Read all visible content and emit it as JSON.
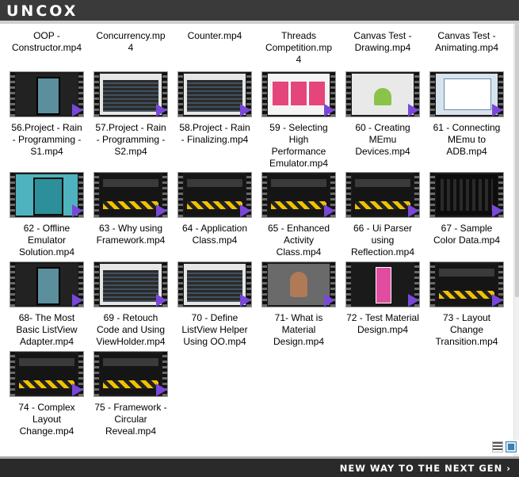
{
  "header": {
    "brand": "UNCOX"
  },
  "footer": {
    "tagline": "NEW WAY TO THE NEXT GEN ›"
  },
  "files": [
    {
      "label": "OOP -\nConstructor.mp4",
      "thumb": "none"
    },
    {
      "label": "Concurrency.mp\n4",
      "thumb": "none"
    },
    {
      "label": "Counter.mp4",
      "thumb": "none"
    },
    {
      "label": "Threads\nCompetition.mp\n4",
      "thumb": "none"
    },
    {
      "label": "Canvas Test -\nDrawing.mp4",
      "thumb": "none"
    },
    {
      "label": "Canvas Test -\nAnimating.mp4",
      "thumb": "none"
    },
    {
      "label": "56.Project - Rain\n- Programming -\nS1.mp4",
      "thumb": "phone"
    },
    {
      "label": "57.Project - Rain\n- Programming -\nS2.mp4",
      "thumb": "ide"
    },
    {
      "label": "58.Project - Rain\n- Finalizing.mp4",
      "thumb": "ide"
    },
    {
      "label": "59 - Selecting\nHigh\nPerformance\nEmulator.mp4",
      "thumb": "web"
    },
    {
      "label": "60 - Creating\nMEmu\nDevices.mp4",
      "thumb": "android"
    },
    {
      "label": "61 - Connecting\nMEmu to\nADB.mp4",
      "thumb": "win"
    },
    {
      "label": "62 - Offline\nEmulator\nSolution.mp4",
      "thumb": "tablet"
    },
    {
      "label": "63 - Why using\nFramework.mp4",
      "thumb": "promo"
    },
    {
      "label": "64 - Application\nClass.mp4",
      "thumb": "promo"
    },
    {
      "label": "65 - Enhanced\nActivity\nClass.mp4",
      "thumb": "promo"
    },
    {
      "label": "66 - Ui Parser\nusing\nReflection.mp4",
      "thumb": "promo"
    },
    {
      "label": "67 - Sample\nColor Data.mp4",
      "thumb": "dark"
    },
    {
      "label": "68- The Most\nBasic ListView\nAdapter.mp4",
      "thumb": "phone"
    },
    {
      "label": "69 - Retouch\nCode and Using\nViewHolder.mp4",
      "thumb": "ide"
    },
    {
      "label": "70 - Define\nListView Helper\nUsing OO.mp4",
      "thumb": "ide"
    },
    {
      "label": "71- What is\nMaterial\nDesign.mp4",
      "thumb": "person"
    },
    {
      "label": "72 - Test Material\nDesign.mp4",
      "thumb": "material"
    },
    {
      "label": "73 - Layout\nChange\nTransition.mp4",
      "thumb": "promo"
    },
    {
      "label": "74 - Complex\nLayout\nChange.mp4",
      "thumb": "promo"
    },
    {
      "label": "75 - Framework -\nCircular\nReveal.mp4",
      "thumb": "promo"
    }
  ]
}
